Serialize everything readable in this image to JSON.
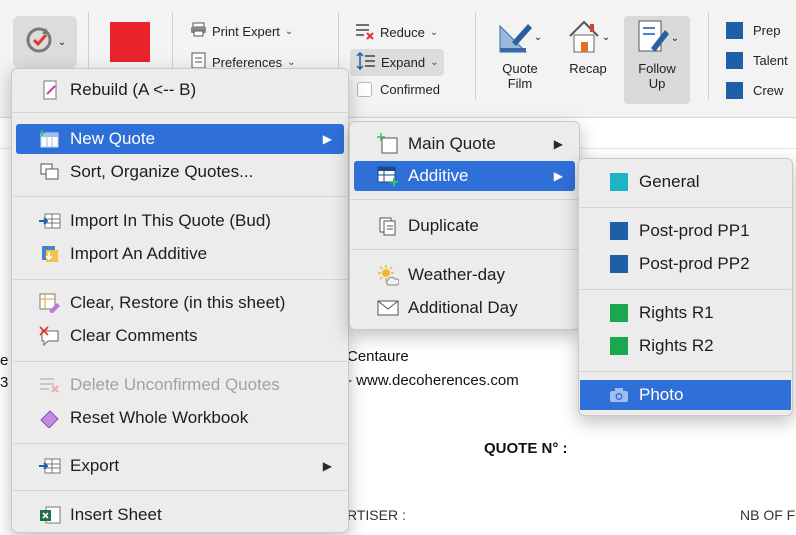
{
  "ribbon": {
    "print_expert": "Print Expert",
    "preferences": "Preferences",
    "reduce": "Reduce",
    "expand": "Expand",
    "confirmed": "Confirmed",
    "quote_film_1": "Quote",
    "quote_film_2": "Film",
    "recap": "Recap",
    "follow_up_1": "Follow",
    "follow_up_2": "Up",
    "legend": [
      "Prep",
      "Talent",
      "Crew"
    ],
    "red_swatch_color": "#e8232b",
    "legend_color": "#1f5fa8"
  },
  "sheet": {
    "company_name": "Centaure",
    "website": "- www.decoherences.com",
    "quote_number_label": "QUOTE N° :",
    "advertiser_label": "RTISER :",
    "nb_label": "NB OF F",
    "edge_left_1": "e",
    "edge_left_2": "3"
  },
  "main_menu": {
    "items": {
      "rebuild": "Rebuild (A <-- B)",
      "new_quote": "New Quote",
      "sort": "Sort, Organize Quotes...",
      "import_quote": "Import In This Quote (Bud)",
      "import_additive": "Import An Additive",
      "clear_restore": "Clear, Restore (in this sheet)",
      "clear_comments": "Clear Comments",
      "delete_unconfirmed": "Delete Unconfirmed Quotes",
      "reset_workbook": "Reset Whole Workbook",
      "export": "Export",
      "insert_sheet": "Insert Sheet"
    }
  },
  "new_quote_menu": {
    "main_quote": "Main Quote",
    "additive": "Additive",
    "duplicate": "Duplicate",
    "weather_day": "Weather-day",
    "additional_day": "Additional Day"
  },
  "additive_menu": {
    "general": "General",
    "post_prod_1": "Post-prod PP1",
    "post_prod_2": "Post-prod PP2",
    "rights_1": "Rights R1",
    "rights_2": "Rights R2",
    "photo": "Photo",
    "colors": {
      "general": "#1eb4c8",
      "post_prod": "#1f5fa8",
      "rights": "#1aa84f",
      "photo_icon": "#9fc0ee"
    }
  },
  "colors": {
    "highlight": "#2f6fd8"
  }
}
